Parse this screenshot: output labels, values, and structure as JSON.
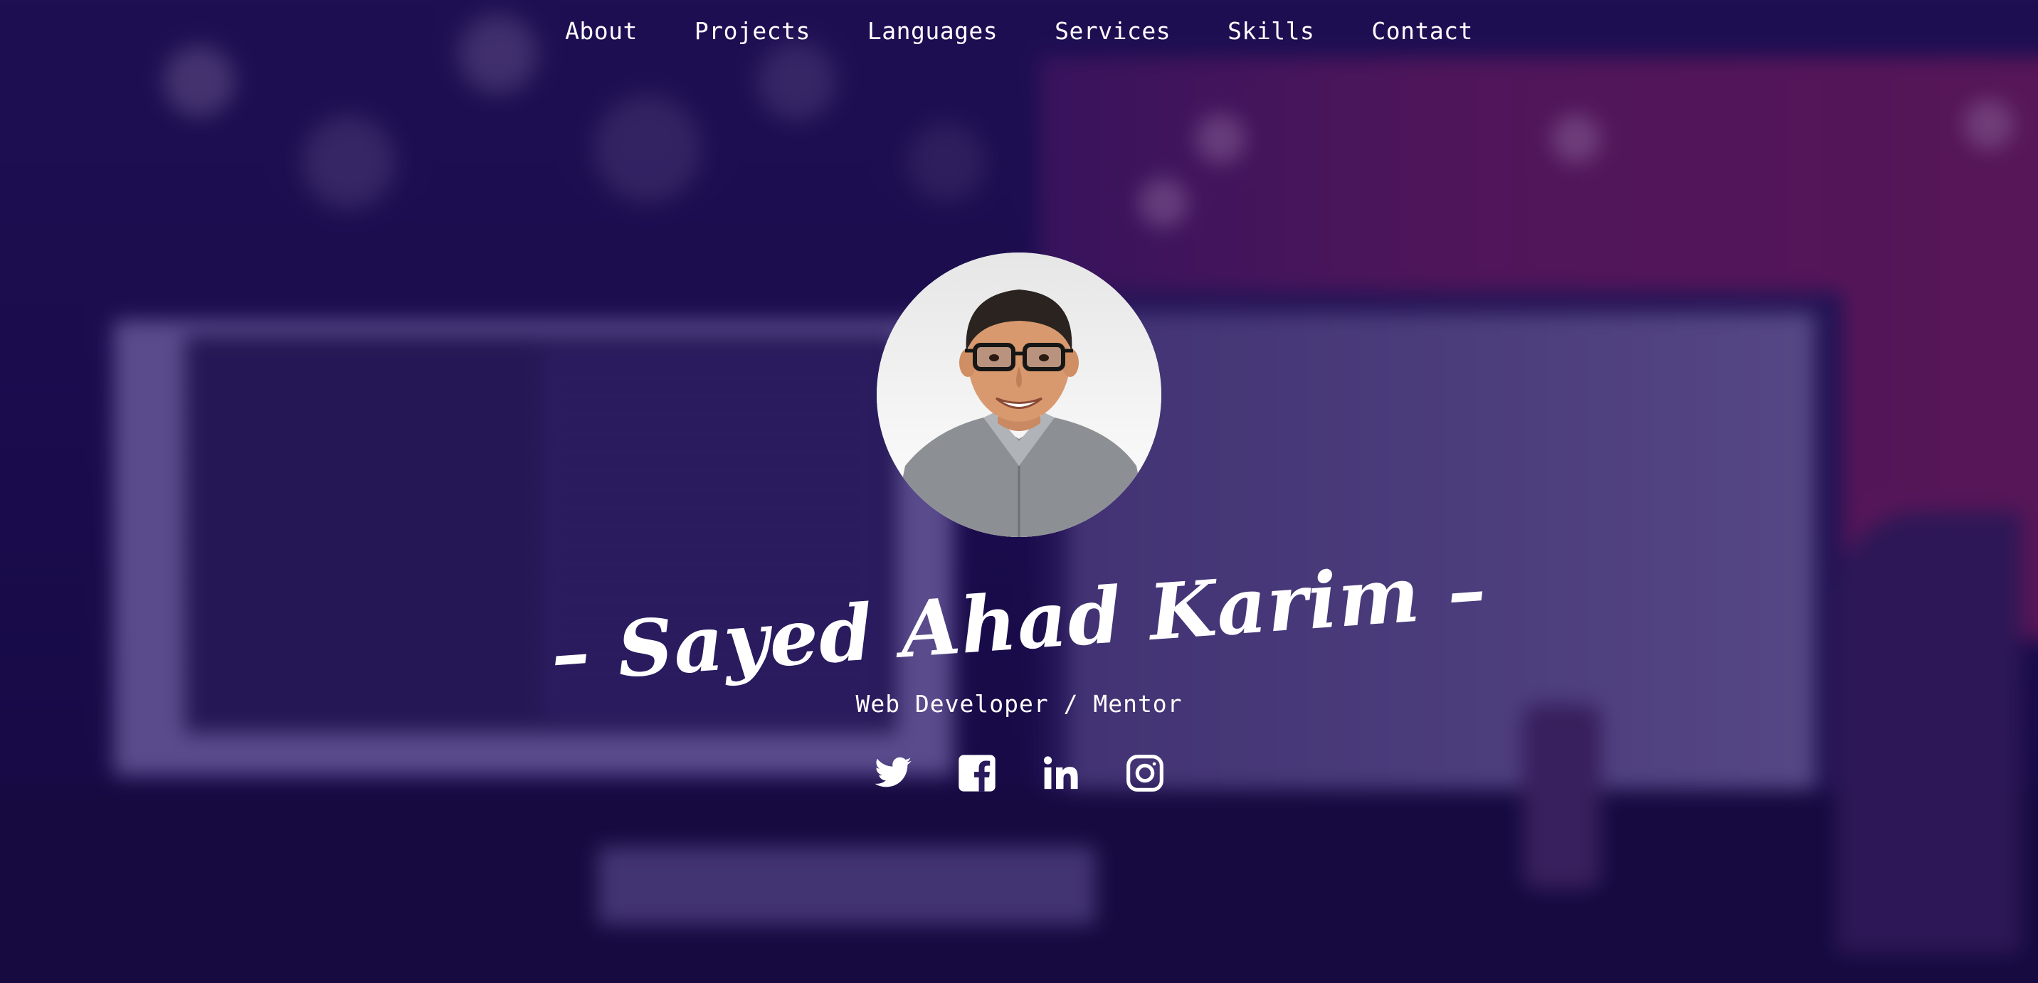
{
  "nav": {
    "items": [
      {
        "label": "About"
      },
      {
        "label": "Projects"
      },
      {
        "label": "Languages"
      },
      {
        "label": "Services"
      },
      {
        "label": "Skills"
      },
      {
        "label": "Contact"
      }
    ]
  },
  "hero": {
    "name": "– Sayed Ahad Karim –",
    "tagline": "Web Developer / Mentor"
  },
  "socials": [
    {
      "icon": "twitter-icon"
    },
    {
      "icon": "facebook-icon"
    },
    {
      "icon": "linkedin-icon"
    },
    {
      "icon": "instagram-icon"
    }
  ],
  "colors": {
    "text": "#ffffff",
    "overlay": "#1a0d4a",
    "accent": "#7a1e62"
  }
}
